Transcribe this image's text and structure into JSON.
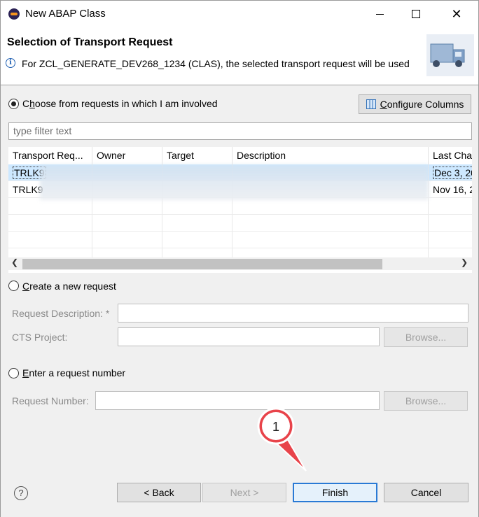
{
  "window": {
    "title": "New ABAP Class"
  },
  "header": {
    "title": "Selection of Transport Request",
    "message": "For ZCL_GENERATE_DEV268_1234 (CLAS), the selected transport request will be used"
  },
  "choose": {
    "label_prefix": "C",
    "label_hot": "h",
    "label_rest": "oose from requests in which I am involved",
    "checked": true
  },
  "configure": {
    "label_hot": "C",
    "label_rest": "onfigure Columns"
  },
  "filter": {
    "placeholder": "type filter text",
    "value": ""
  },
  "table": {
    "columns": [
      "Transport Req...",
      "Owner",
      "Target",
      "Description",
      "Last Cha"
    ],
    "rows": [
      {
        "request": "TRLK9",
        "last_changed": "Dec 3, 20",
        "selected": true
      },
      {
        "request": "TRLK9",
        "last_changed": "Nov 16, 2",
        "selected": false
      }
    ]
  },
  "create": {
    "label_hot": "C",
    "label_rest": "reate a new request",
    "checked": false
  },
  "request_description": {
    "label": "Request Description: *",
    "value": ""
  },
  "cts_project": {
    "label": "CTS Project:",
    "value": ""
  },
  "browse_label": "Browse...",
  "enter": {
    "label_hot": "E",
    "label_rest": "nter a request number",
    "checked": false
  },
  "request_number": {
    "label": "Request Number:",
    "value": ""
  },
  "buttons": {
    "back": "< Back",
    "next": "Next >",
    "finish": "Finish",
    "cancel": "Cancel"
  },
  "callout": {
    "number": "1"
  },
  "colors": {
    "accent": "#2a7ad5",
    "selection": "#cde8ff",
    "callout": "#e8434a"
  }
}
